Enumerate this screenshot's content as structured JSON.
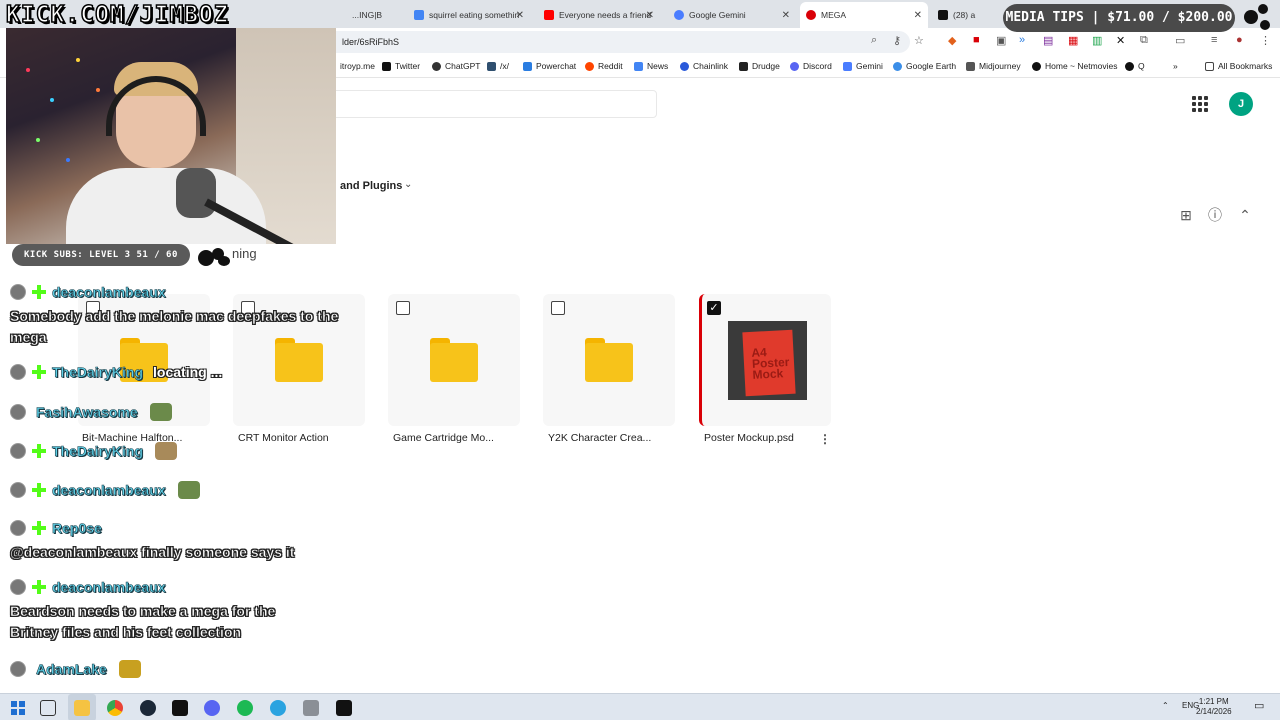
{
  "tabs": [
    {
      "title": "...ING|B",
      "color": "#888888"
    },
    {
      "title": "squirrel eating somethin",
      "color": "#4285f4"
    },
    {
      "title": "Everyone needs a friend",
      "color": "#ff0000"
    },
    {
      "title": "Google Gemini",
      "color": "#4a7dff"
    },
    {
      "title": "MEGA",
      "color": "#d90007"
    },
    {
      "title": "(28) a",
      "color": "#111111"
    }
  ],
  "url": "lder/6sRiFbhS",
  "bookmarks": [
    {
      "label": "itroyp.me",
      "color": "#999999"
    },
    {
      "label": "Twitter",
      "color": "#111111"
    },
    {
      "label": "ChatGPT",
      "color": "#333333"
    },
    {
      "label": "/x/",
      "color": "#2f4f6f"
    },
    {
      "label": "Powerchat",
      "color": "#2a7de1"
    },
    {
      "label": "Reddit",
      "color": "#ff4500"
    },
    {
      "label": "News",
      "color": "#4285f4"
    },
    {
      "label": "Chainlink",
      "color": "#2a5ada"
    },
    {
      "label": "Drudge",
      "color": "#222222"
    },
    {
      "label": "Discord",
      "color": "#5865f2"
    },
    {
      "label": "Gemini",
      "color": "#4a7dff"
    },
    {
      "label": "Google Earth",
      "color": "#3b8ee8"
    },
    {
      "label": "Midjourney",
      "color": "#555555"
    },
    {
      "label": "Home ~ Netmovies",
      "color": "#111111"
    },
    {
      "label": "Q",
      "color": "#111111"
    }
  ],
  "all_bookmarks": "All Bookmarks",
  "mega": {
    "avatar_letter": "J",
    "breadcrumb": "and Plugins",
    "partial_heading": "ning",
    "items": [
      {
        "name": "Bit-Machine Halfton...",
        "type": "folder",
        "checked": false
      },
      {
        "name": "CRT Monitor Action",
        "type": "folder",
        "checked": false
      },
      {
        "name": "Game Cartridge Mo...",
        "type": "folder",
        "checked": false
      },
      {
        "name": "Y2K Character Crea...",
        "type": "folder",
        "checked": false
      },
      {
        "name": "Poster Mockup.psd",
        "type": "file",
        "checked": true
      }
    ],
    "poster_text": "A4 Poster Mock"
  },
  "overlay": {
    "stream_url": "KICK.COM/JIMBOZ",
    "media_tips": "MEDIA TIPS | $71.00 / $200.00",
    "kick_subs": "KICK SUBS: LEVEL 3 51 / 60"
  },
  "chat": [
    {
      "user": "deaconlambeaux",
      "badge": true,
      "message": "Somebody add the melonie mac deepfakes to the mega"
    },
    {
      "user": "TheDairyKing",
      "badge": true,
      "inline": "locating ...",
      "message": ""
    },
    {
      "user": "FasihAwasome",
      "badge": false,
      "emote": true,
      "message": ""
    },
    {
      "user": "TheDairyKing",
      "badge": true,
      "emote": true,
      "message": ""
    },
    {
      "user": "deaconlambeaux",
      "badge": true,
      "emote": true,
      "message": ""
    },
    {
      "user": "Rep0se",
      "badge": true,
      "message": "@deaconlambeaux finally someone says it"
    },
    {
      "user": "deaconlambeaux",
      "badge": true,
      "message": "Beardson needs to make a mega for the Britney files and his feet collection"
    },
    {
      "user": "AdamLake",
      "badge": false,
      "emote": true,
      "message": ""
    }
  ],
  "taskbar": {
    "lang": "ENG",
    "time": "1:21 PM",
    "date": "2/14/2026"
  }
}
